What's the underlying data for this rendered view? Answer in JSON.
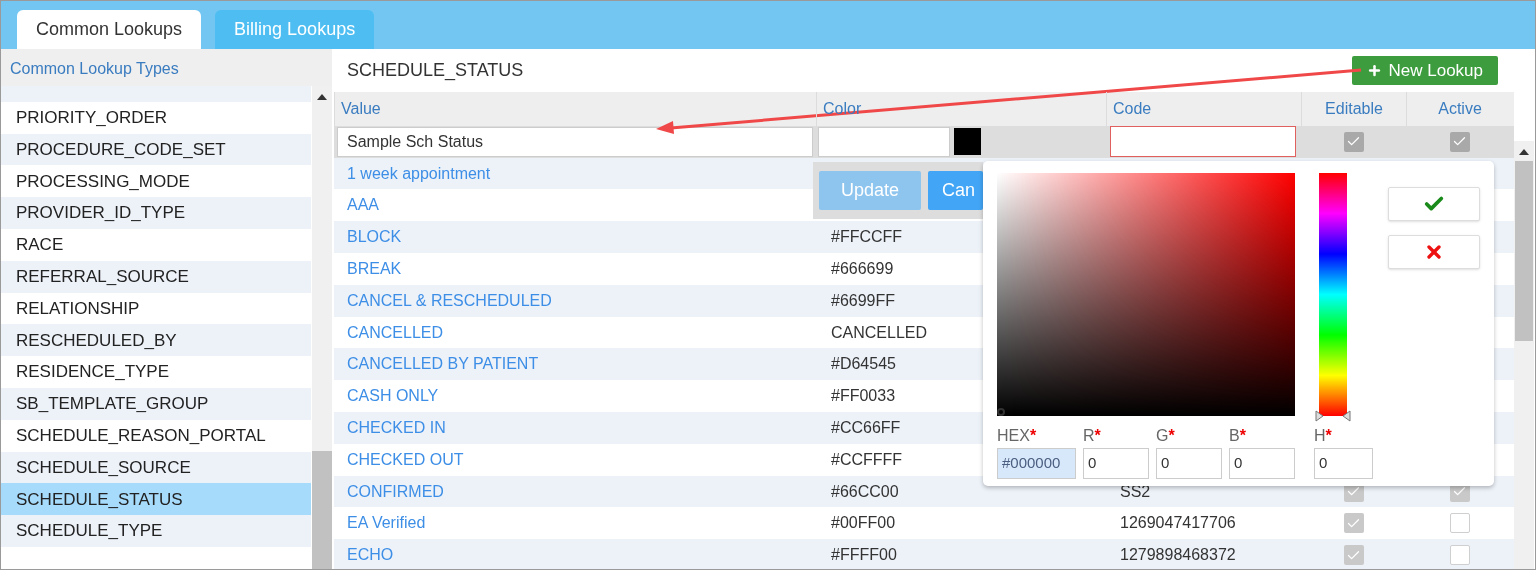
{
  "tabs": [
    {
      "label": "Common Lookups",
      "selected": true
    },
    {
      "label": "Billing Lookups",
      "selected": false
    }
  ],
  "sidebar": {
    "title": "Common Lookup Types",
    "items": [
      {
        "label": "PRIORITY_ORDER",
        "selected": false
      },
      {
        "label": "PROCEDURE_CODE_SET",
        "selected": false
      },
      {
        "label": "PROCESSING_MODE",
        "selected": false
      },
      {
        "label": "PROVIDER_ID_TYPE",
        "selected": false
      },
      {
        "label": "RACE",
        "selected": false
      },
      {
        "label": "REFERRAL_SOURCE",
        "selected": false
      },
      {
        "label": "RELATIONSHIP",
        "selected": false
      },
      {
        "label": "RESCHEDULED_BY",
        "selected": false
      },
      {
        "label": "RESIDENCE_TYPE",
        "selected": false
      },
      {
        "label": "SB_TEMPLATE_GROUP",
        "selected": false
      },
      {
        "label": "SCHEDULE_REASON_PORTAL",
        "selected": false
      },
      {
        "label": "SCHEDULE_SOURCE",
        "selected": false
      },
      {
        "label": "SCHEDULE_STATUS",
        "selected": true
      },
      {
        "label": "SCHEDULE_TYPE",
        "selected": false
      }
    ]
  },
  "main": {
    "title": "SCHEDULE_STATUS",
    "new_button": "New Lookup",
    "columns": [
      "Value",
      "Color",
      "Code",
      "Editable",
      "Active"
    ],
    "edit_row": {
      "value": "Sample Sch Status",
      "code_invalid": true,
      "editable": true,
      "active": true
    },
    "edit_buttons": [
      {
        "label": "Update",
        "disabled": true
      },
      {
        "label": "Can",
        "disabled": false
      }
    ],
    "rows": [
      {
        "value": "1 week appointment"
      },
      {
        "value": "AAA"
      },
      {
        "value": "BLOCK",
        "color_code": "#FFCCFF"
      },
      {
        "value": "BREAK",
        "color_code": "#666699"
      },
      {
        "value": "CANCEL & RESCHEDULED",
        "color_code": "#6699FF"
      },
      {
        "value": "CANCELLED",
        "color_code": "CANCELLED"
      },
      {
        "value": "CANCELLED BY PATIENT",
        "color_code": "#D64545"
      },
      {
        "value": "CASH ONLY",
        "color_code": "#FF0033"
      },
      {
        "value": "CHECKED IN",
        "color_code": "#CC66FF"
      },
      {
        "value": "CHECKED OUT",
        "color_code": "#CCFFFF"
      },
      {
        "value": "CONFIRMED",
        "color_code": "#66CC00",
        "code": "SS2",
        "editable": true,
        "active": true
      },
      {
        "value": "EA Verified",
        "color_code": "#00FF00",
        "code": "1269047417706",
        "editable": true,
        "active": false
      },
      {
        "value": "ECHO",
        "color_code": "#FFFF00",
        "code": "1279898468372",
        "editable": true,
        "active": false
      }
    ]
  },
  "color_picker": {
    "hue": {
      "level": 0
    },
    "fields": [
      {
        "label": "HEX",
        "required_mark": "*",
        "value": "#000000",
        "highlighted": true
      },
      {
        "label": "R",
        "required_mark": "*",
        "value": "0",
        "highlighted": false
      },
      {
        "label": "G",
        "required_mark": "*",
        "value": "0",
        "highlighted": false
      },
      {
        "label": "B",
        "required_mark": "*",
        "value": "0",
        "highlighted": false
      },
      {
        "label": "H",
        "required_mark": "*",
        "value": "0",
        "highlighted": false
      }
    ]
  }
}
